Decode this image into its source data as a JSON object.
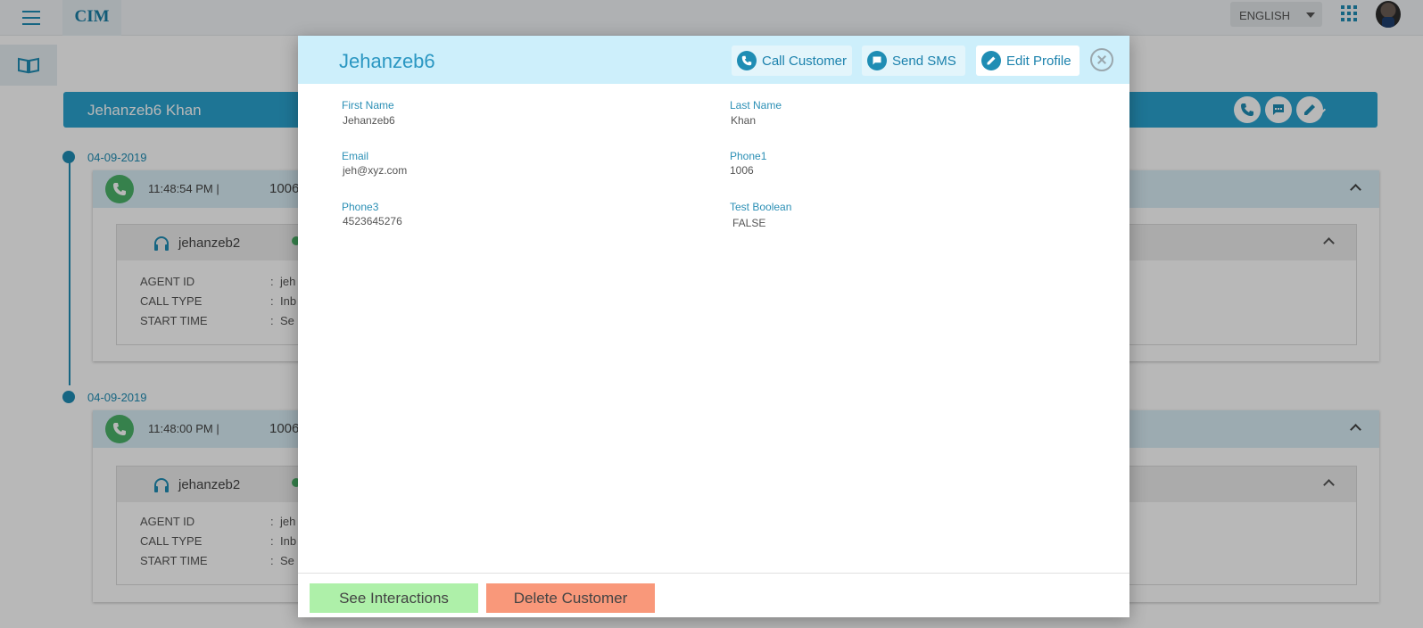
{
  "app": {
    "logo": "CIM",
    "language": "ENGLISH"
  },
  "customer_bar": {
    "name": "Jehanzeb6 Khan"
  },
  "timeline": [
    {
      "date": "04-09-2019",
      "time": "11:48:54 PM  |",
      "number": "1006",
      "agent": "jehanzeb2",
      "details": [
        {
          "label": "AGENT ID",
          "value": "jeh"
        },
        {
          "label": "CALL TYPE",
          "value": "Inb"
        },
        {
          "label": "START TIME",
          "value": "Se"
        }
      ]
    },
    {
      "date": "04-09-2019",
      "time": "11:48:00 PM  |",
      "number": "1006",
      "agent": "jehanzeb2",
      "details": [
        {
          "label": "AGENT ID",
          "value": "jeh"
        },
        {
          "label": "CALL TYPE",
          "value": "Inb"
        },
        {
          "label": "START TIME",
          "value": "Se"
        }
      ]
    }
  ],
  "modal": {
    "title": "Jehanzeb6",
    "buttons": {
      "call": "Call Customer",
      "sms": "Send SMS",
      "edit": "Edit Profile"
    },
    "fields": [
      {
        "label": "First Name",
        "value": "Jehanzeb6"
      },
      {
        "label": "Last Name",
        "value": "Khan"
      },
      {
        "label": "Email",
        "value": "jeh@xyz.com"
      },
      {
        "label": "Phone1",
        "value": "1006"
      },
      {
        "label": "Phone3",
        "value": "4523645276"
      },
      {
        "label": "Test Boolean",
        "value": "FALSE"
      }
    ],
    "footer": {
      "interactions": "See Interactions",
      "delete": "Delete Customer"
    }
  },
  "colors": {
    "primary": "#1f8db4",
    "bar": "#2aa3cf",
    "modal_header": "#cdeffb",
    "success_button": "#aef0a9",
    "danger_button": "#f9987a"
  }
}
